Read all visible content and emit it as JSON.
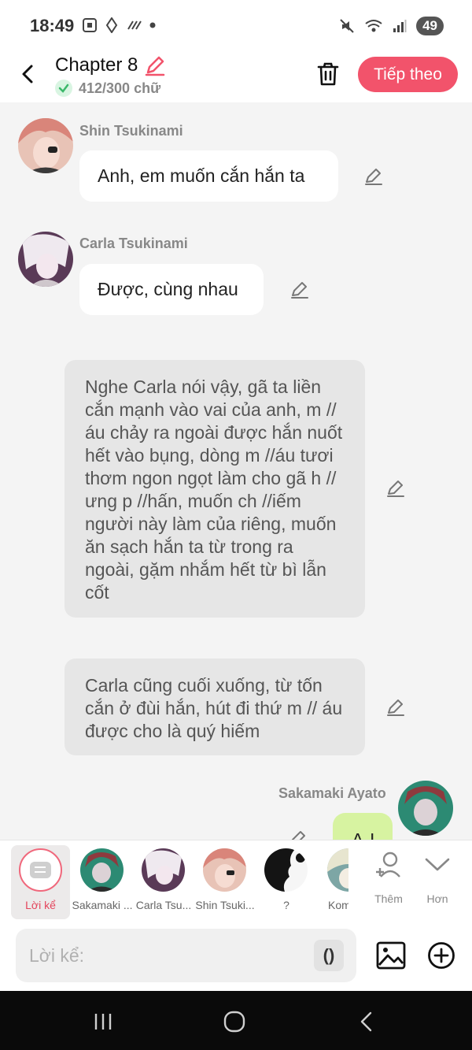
{
  "status": {
    "time": "18:49",
    "battery": "49"
  },
  "header": {
    "title": "Chapter 8",
    "word_count": "412/300 chữ",
    "next_label": "Tiếp theo"
  },
  "messages": [
    {
      "speaker": "Shin Tsukinami",
      "text": "Anh, em muốn cắn hắn ta"
    },
    {
      "speaker": "Carla Tsukinami",
      "text": "Được, cùng nhau"
    },
    {
      "narration": "Nghe Carla nói vậy, gã ta liền cắn mạnh vào vai của anh, m //áu chảy ra ngoài được hắn nuốt hết vào bụng, dòng m //áu tươi thơm ngon ngọt làm cho gã h //ưng p //hấn, muốn ch //iếm người này làm của riêng, muốn ăn sạch hắn ta từ trong ra ngoài, gặm nhắm hết từ bì lẫn cốt"
    },
    {
      "narration": "Carla cũng cuối xuống, từ tốn cắn ở đùi hắn, hút đi thứ m // áu được cho là quý hiếm"
    },
    {
      "speaker": "Sakamaki Ayato",
      "text": "A-I"
    }
  ],
  "characters": {
    "narrator": "Lời kể",
    "items": [
      "Sakamaki ...",
      "Carla Tsu...",
      "Shin Tsuki...",
      "?",
      "Komo"
    ],
    "add_label": "Thêm",
    "more_label": "Hơn"
  },
  "input": {
    "placeholder": "Lời kể:",
    "paren": "()"
  },
  "colors": {
    "accent": "#f2536b",
    "check_green": "#3bb86a"
  }
}
